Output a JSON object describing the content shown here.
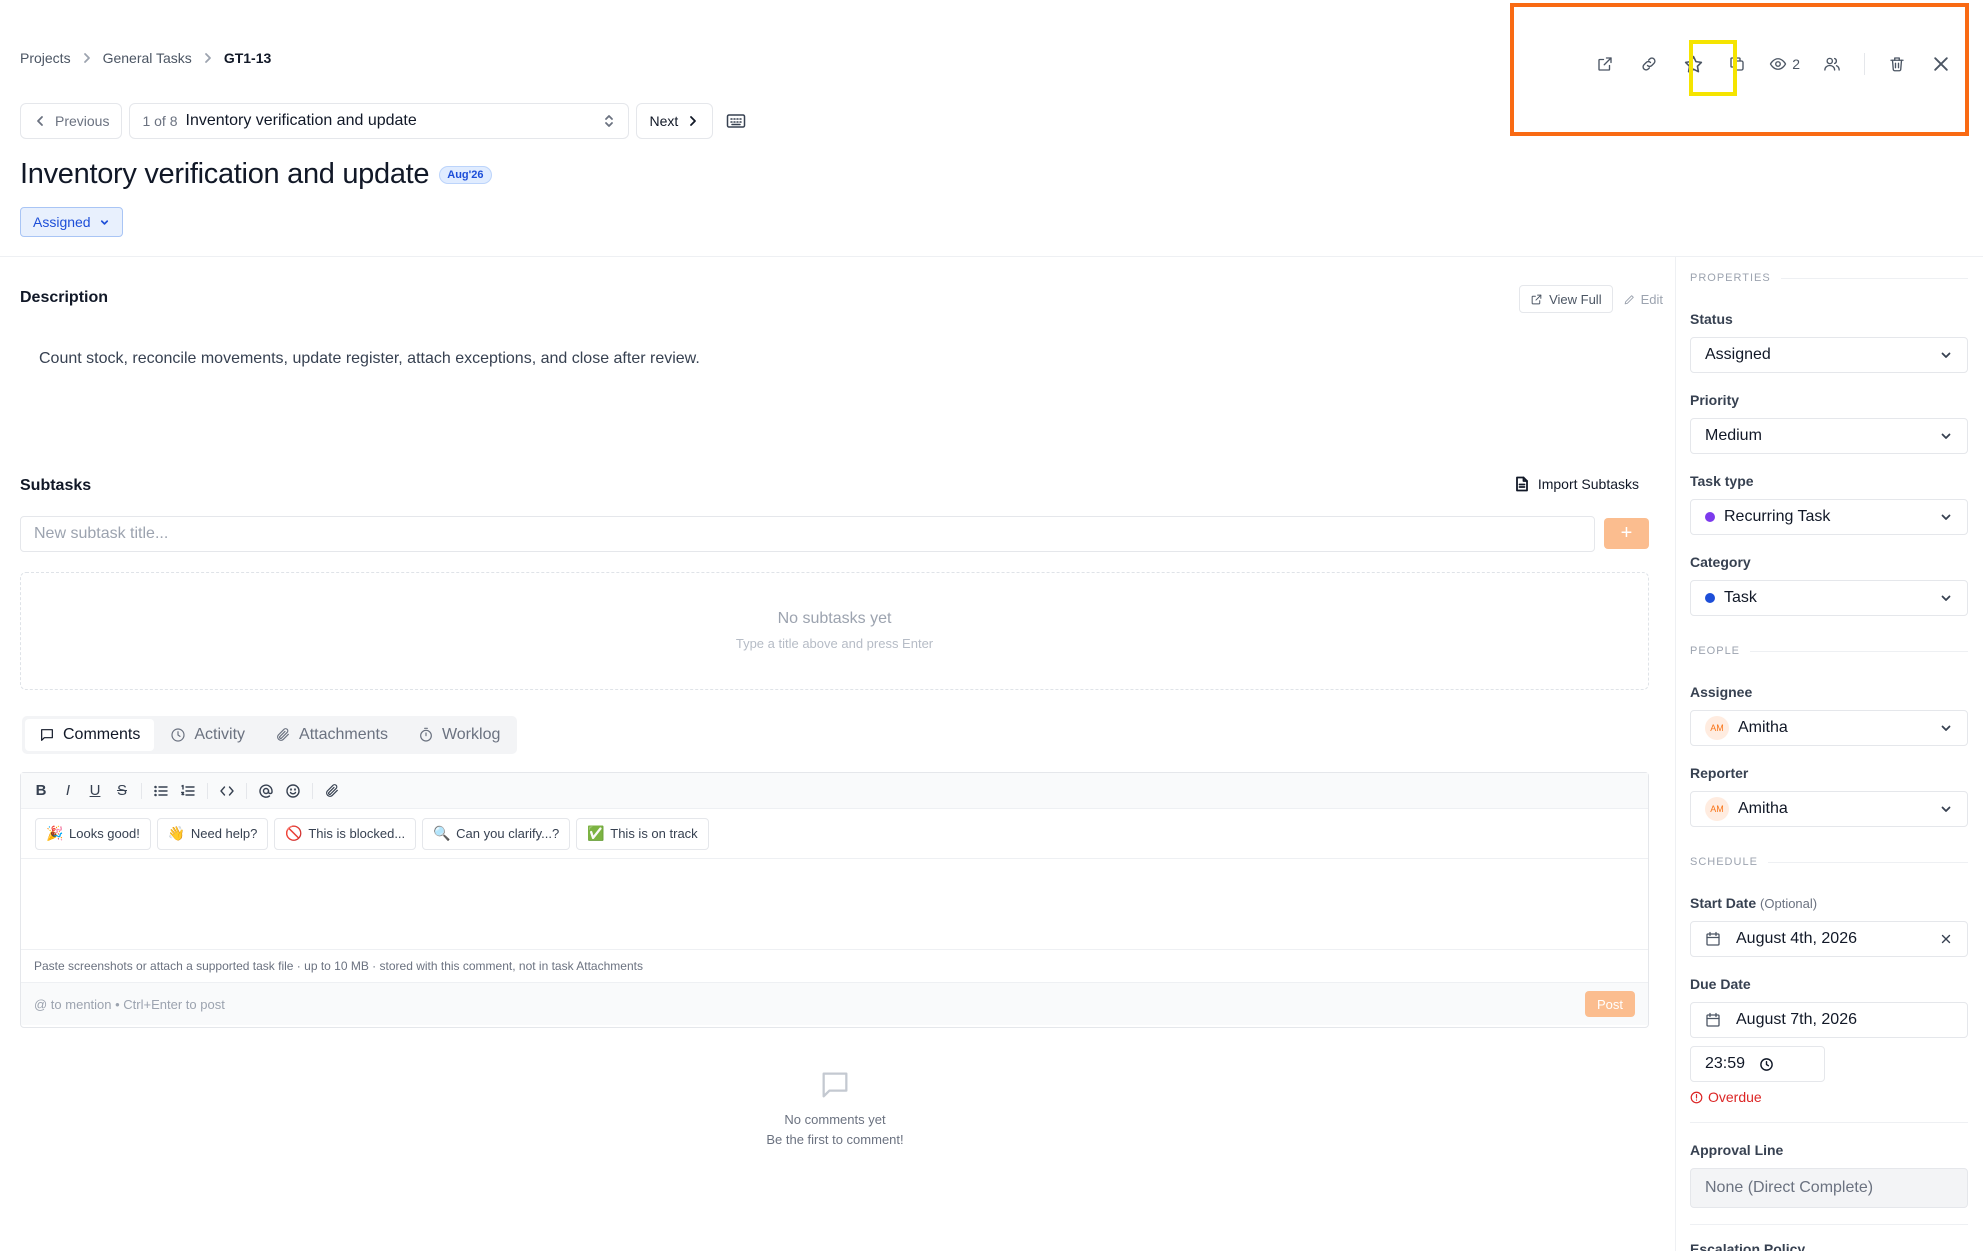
{
  "breadcrumb": {
    "items": [
      "Projects",
      "General Tasks"
    ],
    "current": "GT1-13"
  },
  "toolbar": {
    "watchers": "2"
  },
  "nav": {
    "previous": "Previous",
    "counter": "1 of 8",
    "selected_task": "Inventory verification and update",
    "next": "Next"
  },
  "task": {
    "title": "Inventory verification and update",
    "sprint_badge": "Aug'26",
    "status": "Assigned"
  },
  "description": {
    "heading": "Description",
    "view_full": "View Full",
    "edit": "Edit",
    "text": "Count stock, reconcile movements, update register, attach exceptions, and close after review."
  },
  "subtasks": {
    "heading": "Subtasks",
    "import": "Import Subtasks",
    "placeholder": "New subtask title...",
    "add": "+",
    "empty_title": "No subtasks yet",
    "empty_hint": "Type a title above and press Enter"
  },
  "tabs": [
    "Comments",
    "Activity",
    "Attachments",
    "Worklog"
  ],
  "editor": {
    "format_buttons": [
      "B",
      "I",
      "U",
      "S"
    ],
    "quick_replies": [
      {
        "emoji": "🎉",
        "label": "Looks good!"
      },
      {
        "emoji": "👋",
        "label": "Need help?"
      },
      {
        "emoji": "🚫",
        "label": "This is blocked..."
      },
      {
        "emoji": "🔍",
        "label": "Can you clarify...?"
      },
      {
        "emoji": "✅",
        "label": "This is on track"
      }
    ],
    "attach_hint": "Paste screenshots or attach a supported task file · up to 10 MB · stored with this comment, not in task Attachments",
    "mention_hint": "@ to mention • Ctrl+Enter to post",
    "post": "Post"
  },
  "comments_empty": {
    "title": "No comments yet",
    "hint": "Be the first to comment!"
  },
  "properties": {
    "heading": "PROPERTIES",
    "status_label": "Status",
    "status": "Assigned",
    "priority_label": "Priority",
    "priority": "Medium",
    "task_type_label": "Task type",
    "task_type": "Recurring Task",
    "category_label": "Category",
    "category": "Task"
  },
  "people": {
    "heading": "PEOPLE",
    "assignee_label": "Assignee",
    "assignee": "Amitha",
    "assignee_initials": "AM",
    "reporter_label": "Reporter",
    "reporter": "Amitha",
    "reporter_initials": "AM"
  },
  "schedule": {
    "heading": "SCHEDULE",
    "start_label": "Start Date",
    "start_optional": "(Optional)",
    "start": "August 4th, 2026",
    "due_label": "Due Date",
    "due": "August 7th, 2026",
    "due_time": "23:59",
    "overdue": "Overdue",
    "approval_label": "Approval Line",
    "approval": "None (Direct Complete)",
    "escalation_label": "Escalation Policy"
  },
  "colors": {
    "accent_orange": "#fbbd8f",
    "highlight_orange": "#f96a13",
    "highlight_yellow": "#f5e400",
    "task_type_dot": "#7c3aed",
    "category_dot": "#1d4ed8",
    "overdue_red": "#dc2626"
  }
}
